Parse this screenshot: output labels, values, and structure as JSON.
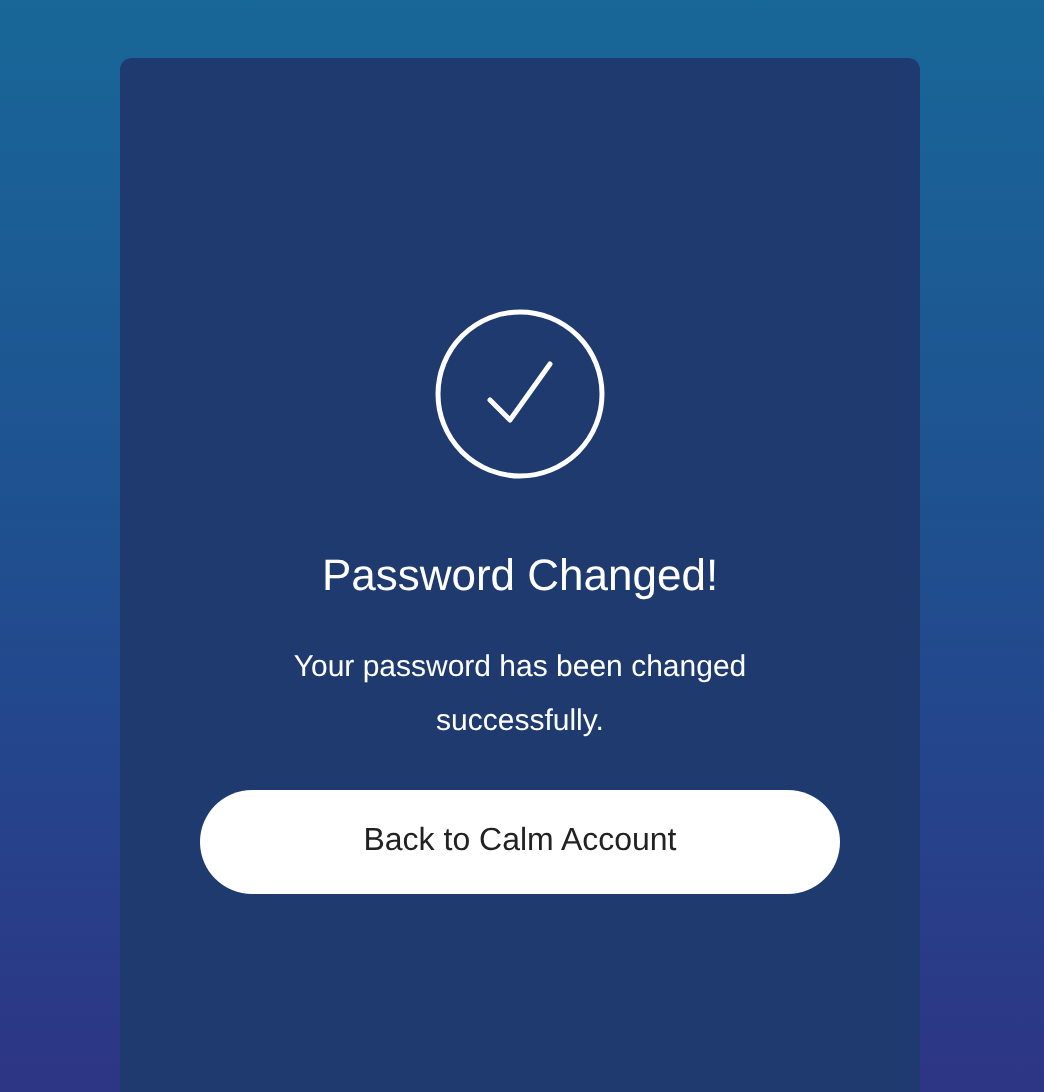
{
  "card": {
    "title": "Password Changed!",
    "message": "Your password has been changed successfully.",
    "button": "Back to Calm Account"
  }
}
